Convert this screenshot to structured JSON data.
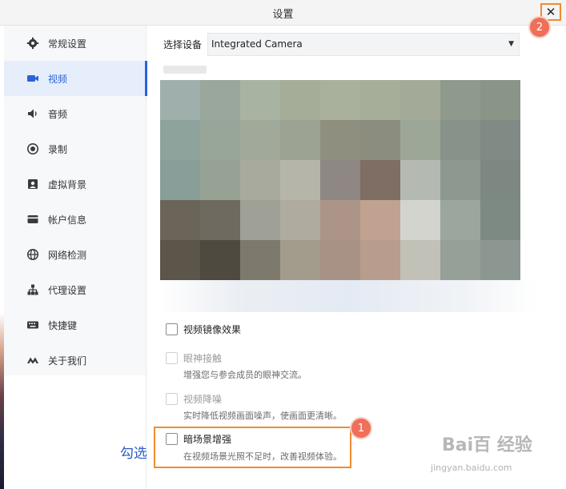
{
  "window": {
    "title": "设置",
    "close_glyph": "✕"
  },
  "sidebar": {
    "items": [
      {
        "label": "常规设置",
        "icon": "gear-icon"
      },
      {
        "label": "视频",
        "icon": "video-camera-icon",
        "active": true
      },
      {
        "label": "音频",
        "icon": "speaker-icon"
      },
      {
        "label": "录制",
        "icon": "record-icon"
      },
      {
        "label": "虚拟背景",
        "icon": "portrait-icon"
      },
      {
        "label": "帐户信息",
        "icon": "card-icon"
      },
      {
        "label": "网络检测",
        "icon": "globe-icon"
      },
      {
        "label": "代理设置",
        "icon": "network-tree-icon"
      },
      {
        "label": "快捷键",
        "icon": "keyboard-icon"
      },
      {
        "label": "关于我们",
        "icon": "logo-m-icon"
      }
    ]
  },
  "device": {
    "label": "选择设备",
    "selected": "Integrated Camera"
  },
  "options": [
    {
      "label": "视频镜像效果",
      "checked": false,
      "enabled": true,
      "description": ""
    },
    {
      "label": "眼神接触",
      "checked": false,
      "enabled": false,
      "description": "增强您与参会成员的眼神交流。"
    },
    {
      "label": "视频降噪",
      "checked": false,
      "enabled": false,
      "description": "实时降低视频画面噪声，使画面更清晰。"
    },
    {
      "label": "暗场景增强",
      "checked": false,
      "enabled": true,
      "description": "在视频场景光照不足时，改善视频体验。"
    }
  ],
  "annotations": {
    "badge_1": "1",
    "badge_2": "2",
    "text": "勾选"
  },
  "watermark": {
    "main": "Bai百 经验",
    "sub": "jingyan.baidu.com"
  },
  "colors": {
    "accent": "#2a63d8",
    "highlight": "#f08c2e",
    "badge": "#ef6f5a"
  }
}
